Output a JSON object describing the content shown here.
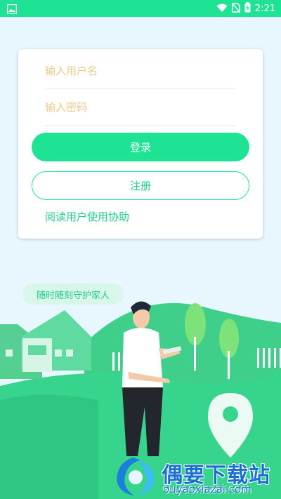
{
  "status_bar": {
    "time": "2:21",
    "icons": [
      "image-icon",
      "wifi-icon",
      "no-sim-icon",
      "battery-charging-icon"
    ],
    "background": "#1fe394"
  },
  "login": {
    "username_placeholder": "输入用户名",
    "password_placeholder": "输入密码",
    "login_label": "登录",
    "register_label": "注册",
    "agreement_label": "阅读用户使用协助"
  },
  "banner": {
    "slogan": "随时随刻守护家人"
  },
  "watermark": {
    "title": "偶要下载站",
    "url": "ouyaoxiazai.com"
  },
  "colors": {
    "accent": "#1fe394",
    "accent_text": "#1fcc8a",
    "placeholder": "#e9cc8a",
    "background": "#e8f6fd"
  }
}
